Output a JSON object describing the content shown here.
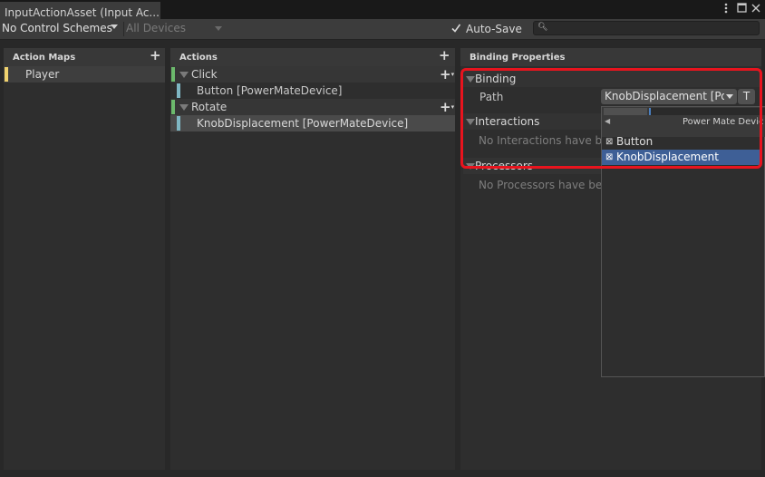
{
  "window": {
    "tab_title": "InputActionAsset (Input Ac...",
    "menu_icon": "kebab-menu-icon",
    "maximize_icon": "maximize-icon",
    "close_icon": "close-icon"
  },
  "toolbar": {
    "control_schemes": "No Control Schemes",
    "devices": "All Devices",
    "auto_save_label": "Auto-Save",
    "auto_save_checked": true,
    "search_value": ""
  },
  "action_maps": {
    "header": "Action Maps",
    "items": [
      {
        "label": "Player",
        "selected": true,
        "color": "#f0d26e"
      }
    ]
  },
  "actions": {
    "header": "Actions",
    "items": [
      {
        "label": "Click",
        "bindings": [
          {
            "label": "Button [PowerMateDevice]"
          }
        ]
      },
      {
        "label": "Rotate",
        "bindings": [
          {
            "label": "KnobDisplacement [PowerMateDevice]",
            "selected": true
          }
        ]
      }
    ],
    "action_color": "#6cb96c",
    "binding_color": "#7fb7c3"
  },
  "properties": {
    "header": "Binding Properties",
    "binding_section": "Binding",
    "path_label": "Path",
    "path_value": "KnobDisplacement [Pov",
    "t_button": "T",
    "interactions_section": "Interactions",
    "interactions_empty": "No Interactions have bee",
    "processors_section": "Processors",
    "processors_empty": "No Processors have bee"
  },
  "dropdown": {
    "title": "Power Mate Devic",
    "items": [
      {
        "label": "Button",
        "selected": false
      },
      {
        "label": "KnobDisplacement",
        "selected": true
      }
    ],
    "selected_color": "#3e5f96"
  },
  "highlight_color": "#e8141e"
}
